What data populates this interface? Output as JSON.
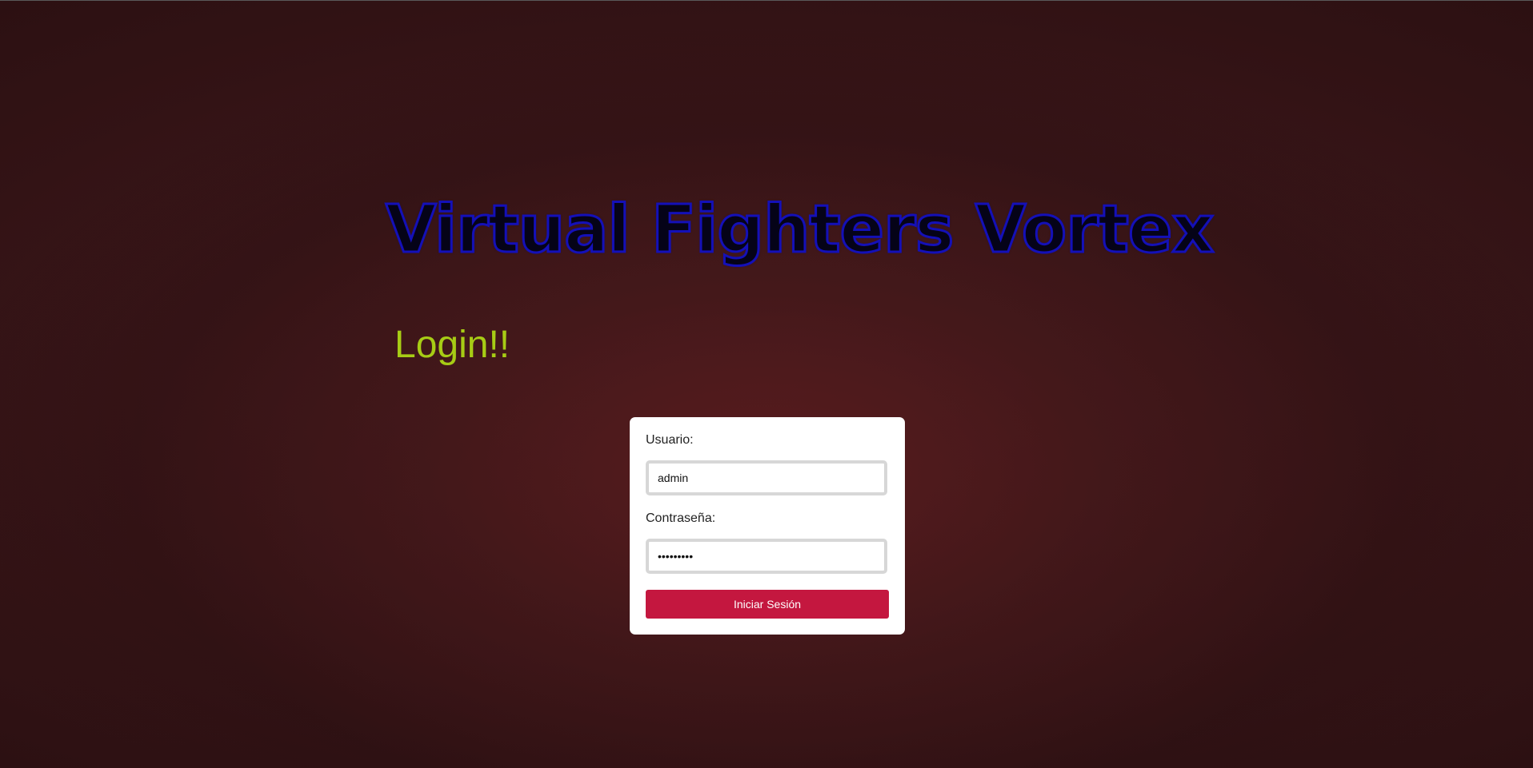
{
  "header": {
    "site_title": "Virtual Fighters Vortex",
    "login_heading": "Login!!"
  },
  "form": {
    "username_label": "Usuario:",
    "username_value": "admin",
    "password_label": "Contraseña:",
    "password_value": "123456789",
    "submit_label": "Iniciar Sesión"
  },
  "colors": {
    "title_fill": "#050318",
    "title_outline": "#1410b8",
    "login_heading": "#a7cc15",
    "submit_button": "#c4173f",
    "background": "#3a1719"
  }
}
